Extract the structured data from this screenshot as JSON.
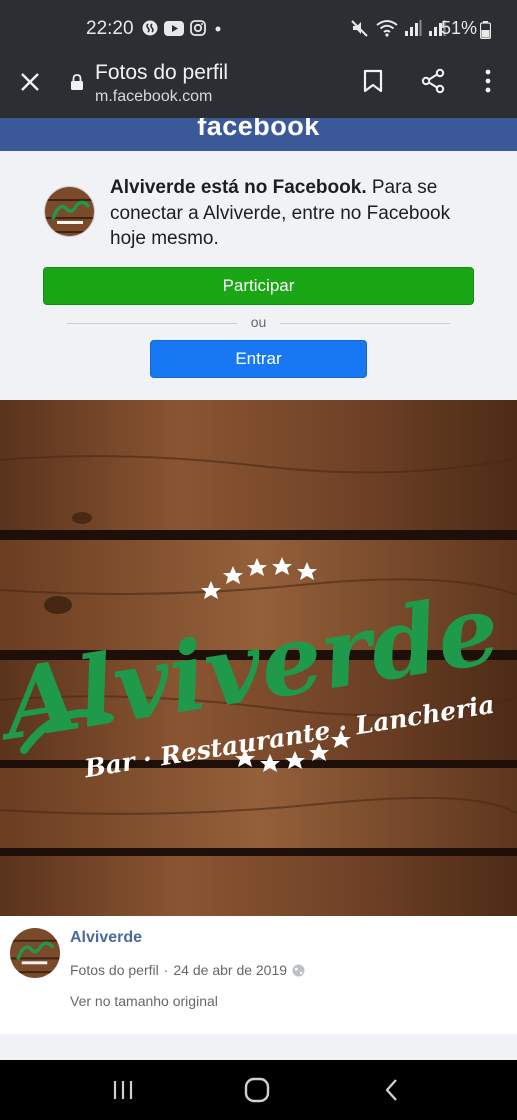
{
  "status_bar": {
    "time": "22:20",
    "battery_percent": "51%",
    "icons_left": [
      "shazam-icon",
      "youtube-icon",
      "instagram-icon",
      "dot-icon"
    ],
    "icons_right": [
      "mute-icon",
      "wifi-icon",
      "signal-icon",
      "signal-icon",
      "battery-icon"
    ]
  },
  "browser_bar": {
    "title": "Fotos do perfil",
    "url": "m.facebook.com",
    "icons": [
      "close-icon",
      "lock-icon",
      "bookmark-icon",
      "share-icon",
      "more-icon"
    ]
  },
  "banner": {
    "logo_text": "facebook",
    "color": "#3b5998"
  },
  "login_panel": {
    "heading": "Alviverde está no Facebook.",
    "message": " Para se conectar a Alviverde, entre no Facebook hoje mesmo.",
    "join_button": "Participar",
    "or_text": "ou",
    "login_button": "Entrar",
    "join_color": "#1aa615",
    "login_color": "#1877f2"
  },
  "photo": {
    "logo_main": "Alviverde",
    "logo_sub": "Bar · Restaurante · Lancheria",
    "logo_color": "#1f9a4a"
  },
  "post": {
    "author": "Alviverde",
    "album": "Fotos do perfil",
    "separator": "·",
    "date": "24 de abr de 2019",
    "view_original": "Ver no tamanho original"
  },
  "nav_bar": {
    "icons": [
      "recent-apps-icon",
      "home-icon",
      "back-icon"
    ]
  }
}
